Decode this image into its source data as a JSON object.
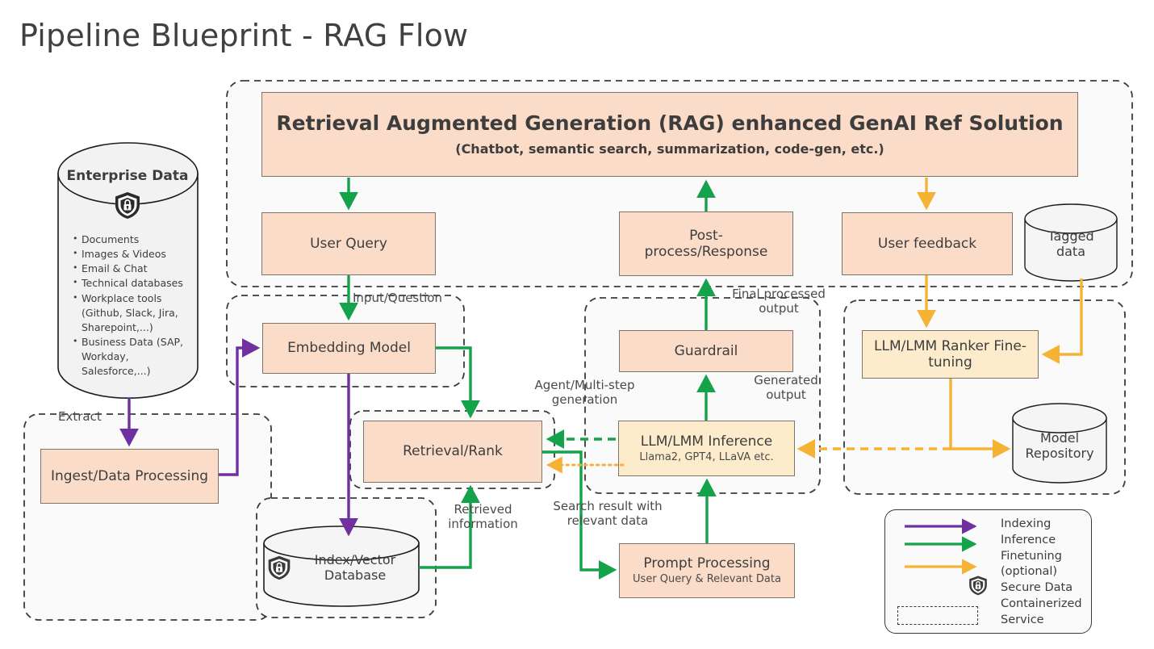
{
  "title": "Pipeline Blueprint - RAG Flow",
  "colors": {
    "indexing": "#7030a0",
    "inference": "#14a34a",
    "finetuning": "#f5b335",
    "node_pink": "#fbdcc9",
    "node_cream": "#fdeccb",
    "node_border": "#7d7566",
    "container_border": "#3b3b3b",
    "container_fill": "#fafafa",
    "text": "#3d3d3d"
  },
  "enterprise_data": {
    "title": "Enterprise Data",
    "icon": "secure-shield-lock-icon",
    "items": [
      "Documents",
      "Images & Videos",
      "Email & Chat",
      "Technical databases",
      "Workplace tools (Github, Slack, Jira, Sharepoint,...)",
      "Business Data (SAP, Workday, Salesforce,...)"
    ]
  },
  "nodes": {
    "rag_header": {
      "title": "Retrieval Augmented Generation (RAG) enhanced GenAI Ref Solution",
      "subtitle": "(Chatbot, semantic search, summarization, code-gen, etc.)"
    },
    "user_query": {
      "title": "User Query"
    },
    "post_process": {
      "title": "Post-process/Response"
    },
    "user_feedback": {
      "title": "User feedback"
    },
    "tagged_data": {
      "title": "Tagged data"
    },
    "embedding_model": {
      "title": "Embedding Model"
    },
    "guardrail": {
      "title": "Guardrail"
    },
    "ranker_finetuning": {
      "title": "LLM/LMM Ranker Fine-tuning"
    },
    "ingest": {
      "title": "Ingest/Data Processing"
    },
    "retrieval_rank": {
      "title": "Retrieval/Rank"
    },
    "llm_inference": {
      "title": "LLM/LMM Inference",
      "subtitle": "Llama2, GPT4, LLaVA etc."
    },
    "model_repository": {
      "title": "Model Repository"
    },
    "index_vector_db": {
      "title": "Index/Vector Database",
      "icon": "secure-shield-lock-icon"
    },
    "prompt_processing": {
      "title": "Prompt Processing",
      "subtitle": "User Query & Relevant Data"
    }
  },
  "edge_labels": {
    "input_question": "Input/Question",
    "final_processed_output": "Final processed\noutput",
    "agent_multistep": "Agent/Multi-step\ngeneration",
    "generated_output": "Generated\noutput",
    "extract": "Extract",
    "retrieved_information": "Retrieved\ninformation",
    "search_result": "Search result with\nrelevant data"
  },
  "legend": {
    "indexing": "Indexing",
    "inference": "Inference",
    "finetuning": "Finetuning (optional)",
    "secure_data": "Secure Data",
    "containerized_service": "Containerized Service",
    "lines": [
      "Indexing",
      "Inference",
      "Finetuning",
      "(optional)",
      "Secure Data",
      "Containerized",
      "Service"
    ],
    "secure_icon": "secure-shield-lock-icon",
    "container_swatch": "dashed-rectangle-swatch"
  }
}
